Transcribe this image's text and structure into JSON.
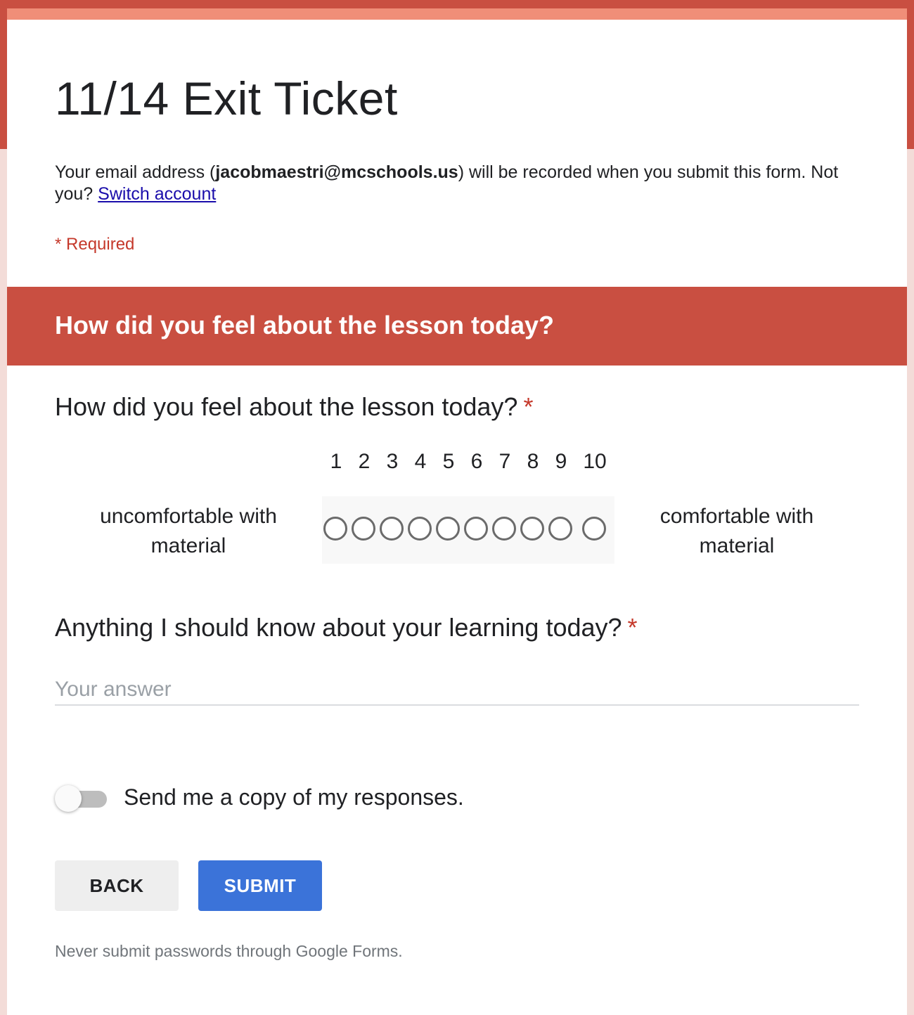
{
  "colors": {
    "header_red": "#c94f41",
    "accent_salmon": "#f08e78",
    "required_red": "#c5392b",
    "submit_blue": "#3b73d9",
    "link_blue": "#1a0dab"
  },
  "form": {
    "title": "11/14 Exit Ticket",
    "email_prefix": "Your email address (",
    "email": "jacobmaestri@mcschools.us",
    "email_suffix": ") will be recorded when you submit this form. Not you? ",
    "switch_account": "Switch account",
    "required_note": "* Required"
  },
  "section": {
    "title": "How did you feel about the lesson today?"
  },
  "questions": [
    {
      "title": "How did you feel about the lesson today?",
      "required_mark": "*",
      "type": "linear-scale",
      "scale": [
        "1",
        "2",
        "3",
        "4",
        "5",
        "6",
        "7",
        "8",
        "9",
        "10"
      ],
      "selected": null,
      "low_label": "uncomfortable with material",
      "high_label": "comfortable with material"
    },
    {
      "title": "Anything I should know about your learning today?",
      "required_mark": "*",
      "type": "short-answer",
      "value": "",
      "placeholder": "Your answer"
    }
  ],
  "send_copy": {
    "label": "Send me a copy of my responses.",
    "enabled": false
  },
  "buttons": {
    "back": "BACK",
    "submit": "SUBMIT"
  },
  "footer": {
    "note": "Never submit passwords through Google Forms."
  }
}
